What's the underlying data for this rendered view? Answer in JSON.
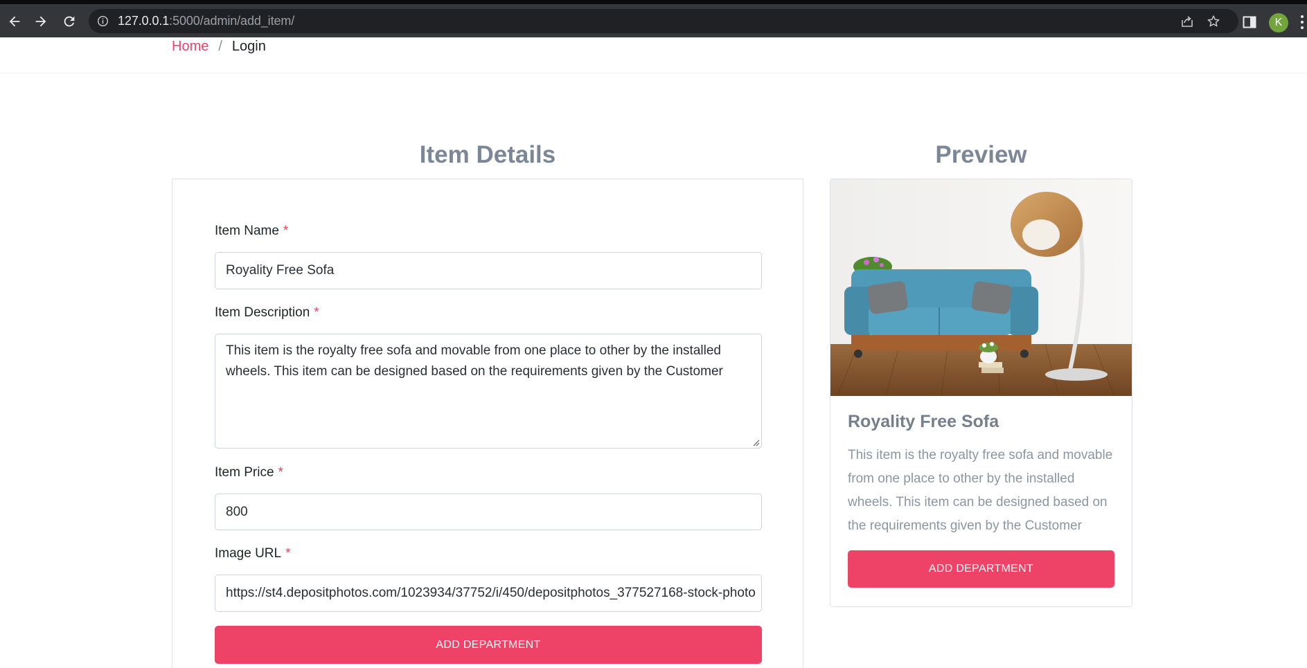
{
  "browser": {
    "url_host": "127.0.0.1",
    "url_rest": ":5000/admin/add_item/",
    "profile_initial": "K",
    "icons": [
      "back-icon",
      "forward-icon",
      "reload-icon",
      "site-info-icon",
      "share-icon",
      "bookmark-star-icon",
      "side-panel-icon",
      "menu-dots-icon"
    ]
  },
  "breadcrumb": {
    "home": "Home",
    "separator": "/",
    "current": "Login"
  },
  "form": {
    "heading": "Item Details",
    "required_mark": "*",
    "fields": {
      "name": {
        "label": "Item Name",
        "value": "Royality Free Sofa"
      },
      "description": {
        "label": "Item Description",
        "value": "This item is the royalty free sofa and movable from one place to other by the installed wheels. This item can be designed based on the requirements given by the Customer"
      },
      "price": {
        "label": "Item Price",
        "value": "800"
      },
      "image_url": {
        "label": "Image URL",
        "value": "https://st4.depositphotos.com/1023934/37752/i/450/depositphotos_377527168-stock-photo"
      }
    },
    "submit_label": "ADD DEPARTMENT"
  },
  "preview": {
    "heading": "Preview",
    "title": "Royality Free Sofa",
    "text": "This item is the royalty free sofa and movable from one place to other by the installed wheels. This item can be designed based on the requirements given by the Customer",
    "button_label": "ADD DEPARTMENT"
  },
  "colors": {
    "accent": "#ee4266",
    "heading": "#7b8796",
    "chrome_bg": "#35363a",
    "omnibox_bg": "#202124",
    "avatar": "#72a53b"
  }
}
